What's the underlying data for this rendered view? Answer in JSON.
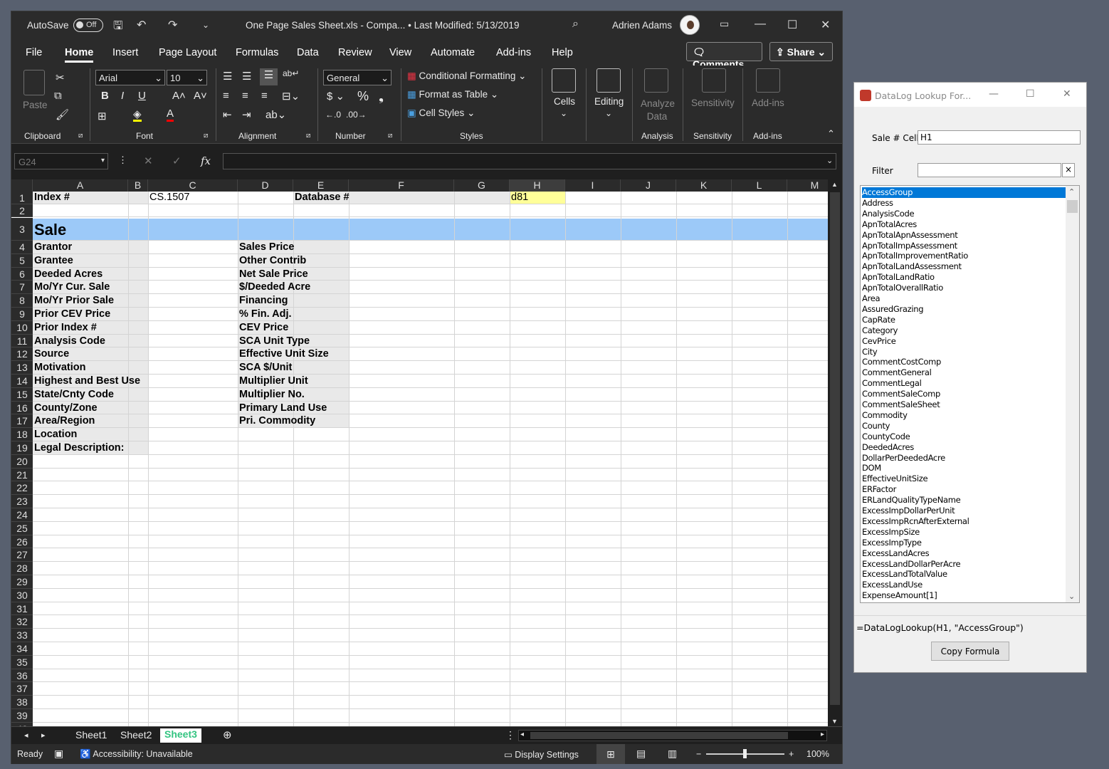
{
  "excel": {
    "autosave_label": "AutoSave",
    "autosave_state": "Off",
    "file_title": "One Page Sales Sheet.xls  -  Compa...  •  Last Modified: 5/13/2019",
    "user_name": "Adrien Adams",
    "menu_tabs": [
      "File",
      "Home",
      "Insert",
      "Page Layout",
      "Formulas",
      "Data",
      "Review",
      "View",
      "Automate",
      "Add-ins",
      "Help"
    ],
    "comments_label": "Comments",
    "share_label": "Share",
    "ribbon": {
      "clipboard": {
        "paste": "Paste",
        "label": "Clipboard"
      },
      "font": {
        "name": "Arial",
        "size": "10",
        "label": "Font"
      },
      "alignment": {
        "label": "Alignment"
      },
      "number": {
        "format": "General",
        "label": "Number"
      },
      "styles": {
        "conditional": "Conditional Formatting",
        "format_table": "Format as Table",
        "cell_styles": "Cell Styles",
        "label": "Styles"
      },
      "cells": {
        "label": "Cells"
      },
      "editing": {
        "label": "Editing"
      },
      "analyze": {
        "btn": "Analyze Data",
        "label": "Analysis"
      },
      "sensitivity": {
        "btn": "Sensitivity",
        "label": "Sensitivity"
      },
      "addins": {
        "btn": "Add-ins",
        "label": "Add-ins"
      }
    },
    "name_box": "G24",
    "fx": "fx",
    "columns": [
      "A",
      "B",
      "C",
      "D",
      "E",
      "F",
      "G",
      "H",
      "I",
      "J",
      "K",
      "L",
      "M"
    ],
    "cells": {
      "a1": "Index #",
      "c1": "CS.1507",
      "e1": "Database #",
      "h1": "d81",
      "a3": "Sale",
      "left_labels": [
        "Grantor",
        "Grantee",
        "Deeded Acres",
        "Mo/Yr Cur. Sale",
        "Mo/Yr Prior Sale",
        "Prior CEV Price",
        "Prior Index #",
        "Analysis Code",
        "Source",
        "Motivation",
        "Highest and Best Use",
        "State/Cnty Code",
        "County/Zone",
        "Area/Region",
        "Location",
        "Legal Description:"
      ],
      "right_labels": [
        "Sales Price",
        "Other Contrib",
        "Net Sale Price",
        "$/Deeded Acre",
        "Financing",
        "% Fin. Adj.",
        "CEV Price",
        "SCA Unit Type",
        "Effective Unit Size",
        "SCA $/Unit",
        "Multiplier Unit",
        "Multiplier No.",
        "Primary Land Use",
        "Pri. Commodity"
      ]
    },
    "sheet_tabs": [
      "Sheet1",
      "Sheet2",
      "Sheet3"
    ],
    "active_sheet": "Sheet3",
    "status": {
      "ready": "Ready",
      "accessibility": "Accessibility: Unavailable",
      "display_settings": "Display Settings",
      "zoom": "100%"
    }
  },
  "dialog": {
    "title": "DataLog Lookup For...",
    "sale_cell_label": "Sale # Cell",
    "sale_cell_value": "H1",
    "filter_label": "Filter",
    "filter_value": "",
    "clear_label": "×",
    "items": [
      "AccessGroup",
      "Address",
      "AnalysisCode",
      "ApnTotalAcres",
      "ApnTotalApnAssessment",
      "ApnTotalImpAssessment",
      "ApnTotalImprovementRatio",
      "ApnTotalLandAssessment",
      "ApnTotalLandRatio",
      "ApnTotalOverallRatio",
      "Area",
      "AssuredGrazing",
      "CapRate",
      "Category",
      "CevPrice",
      "City",
      "CommentCostComp",
      "CommentGeneral",
      "CommentLegal",
      "CommentSaleComp",
      "CommentSaleSheet",
      "Commodity",
      "County",
      "CountyCode",
      "DeededAcres",
      "DollarPerDeededAcre",
      "DOM",
      "EffectiveUnitSize",
      "ERFactor",
      "ERLandQualityTypeName",
      "ExcessImpDollarPerUnit",
      "ExcessImpRcnAfterExternal",
      "ExcessImpSize",
      "ExcessImpType",
      "ExcessLandAcres",
      "ExcessLandDollarPerAcre",
      "ExcessLandTotalValue",
      "ExcessLandUse",
      "ExpenseAmount[1]"
    ],
    "selected_item": "AccessGroup",
    "formula": "=DataLogLookup(H1, \"AccessGroup\")",
    "copy_button": "Copy Formula"
  }
}
